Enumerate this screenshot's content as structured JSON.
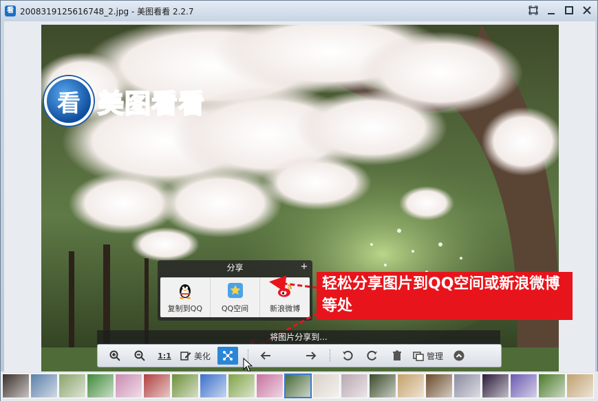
{
  "window": {
    "title": "2008319125616748_2.jpg - 美图看看 2.2.7",
    "icon_glyph": "看"
  },
  "logo": {
    "glyph": "看",
    "text": "美图看看"
  },
  "share_panel": {
    "title": "分享",
    "items": [
      {
        "label": "复制到QQ",
        "icon": "qq-penguin-icon"
      },
      {
        "label": "QQ空间",
        "icon": "qzone-star-icon"
      },
      {
        "label": "新浪微博",
        "icon": "weibo-icon"
      }
    ]
  },
  "callout": {
    "text": "轻松分享图片到QQ空间或新浪微博等处"
  },
  "hint": "将图片分享到...",
  "toolbar": {
    "ratio_label": "1:1",
    "beautify_label": "美化",
    "manage_label": "管理"
  },
  "colors": {
    "accent": "#2a86d6",
    "callout": "#e8141b"
  },
  "filmstrip": {
    "count": 21,
    "selected_index": 10
  }
}
